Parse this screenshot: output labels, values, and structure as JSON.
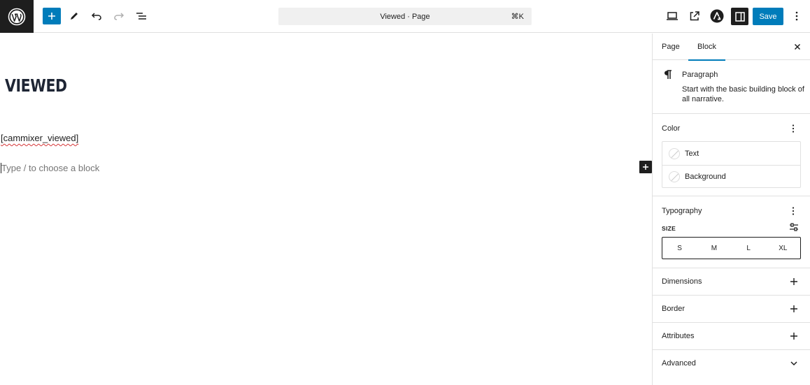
{
  "toolbar": {
    "document_title": "Viewed · Page",
    "shortcut": "⌘K",
    "save_label": "Save",
    "icons": [
      "wordpress-logo",
      "plus-icon",
      "pen-icon",
      "undo-icon",
      "redo-icon",
      "list-view-icon",
      "desktop-preview-icon",
      "external-link-icon",
      "astra-icon",
      "sidebar-toggle-icon",
      "more-vertical-icon"
    ]
  },
  "editor": {
    "title": "VIEWED",
    "shortcode": "[cammixer_viewed]",
    "placeholder": "Type / to choose a block"
  },
  "sidebar": {
    "tabs": [
      {
        "label": "Page"
      },
      {
        "label": "Block"
      }
    ],
    "active_tab": "Block",
    "block": {
      "name": "Paragraph",
      "description": "Start with the basic building block of all narrative."
    },
    "color": {
      "title": "Color",
      "items": [
        {
          "label": "Text"
        },
        {
          "label": "Background"
        }
      ]
    },
    "typography": {
      "title": "Typography",
      "size_label": "SIZE",
      "sizes": [
        "S",
        "M",
        "L",
        "XL"
      ]
    },
    "panels": [
      {
        "title": "Dimensions",
        "icon": "plus-icon"
      },
      {
        "title": "Border",
        "icon": "plus-icon"
      },
      {
        "title": "Attributes",
        "icon": "plus-icon"
      },
      {
        "title": "Advanced",
        "icon": "chevron-down-icon"
      }
    ]
  },
  "colors": {
    "accent": "#007cba",
    "dark": "#1e1e1e",
    "border": "#e0e0e0",
    "command_bar_bg": "#f0f0f0"
  }
}
